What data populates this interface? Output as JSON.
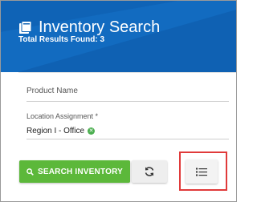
{
  "header": {
    "title": "Inventory Search",
    "results_text": "Total Results Found: 3",
    "background_color": "#0f63b6"
  },
  "fields": {
    "product_name": {
      "label": "Product Name",
      "value": ""
    },
    "location": {
      "label": "Location Assignment *",
      "chips": [
        "Region I - Office"
      ],
      "chip_remove_color": "#4caf50"
    }
  },
  "buttons": {
    "search": {
      "label": "SEARCH INVENTORY",
      "icon": "search-icon",
      "color": "#5cb83a"
    },
    "refresh": {
      "icon": "refresh-icon"
    },
    "list_view": {
      "icon": "list-icon",
      "highlight_color": "#e03a3a"
    }
  }
}
